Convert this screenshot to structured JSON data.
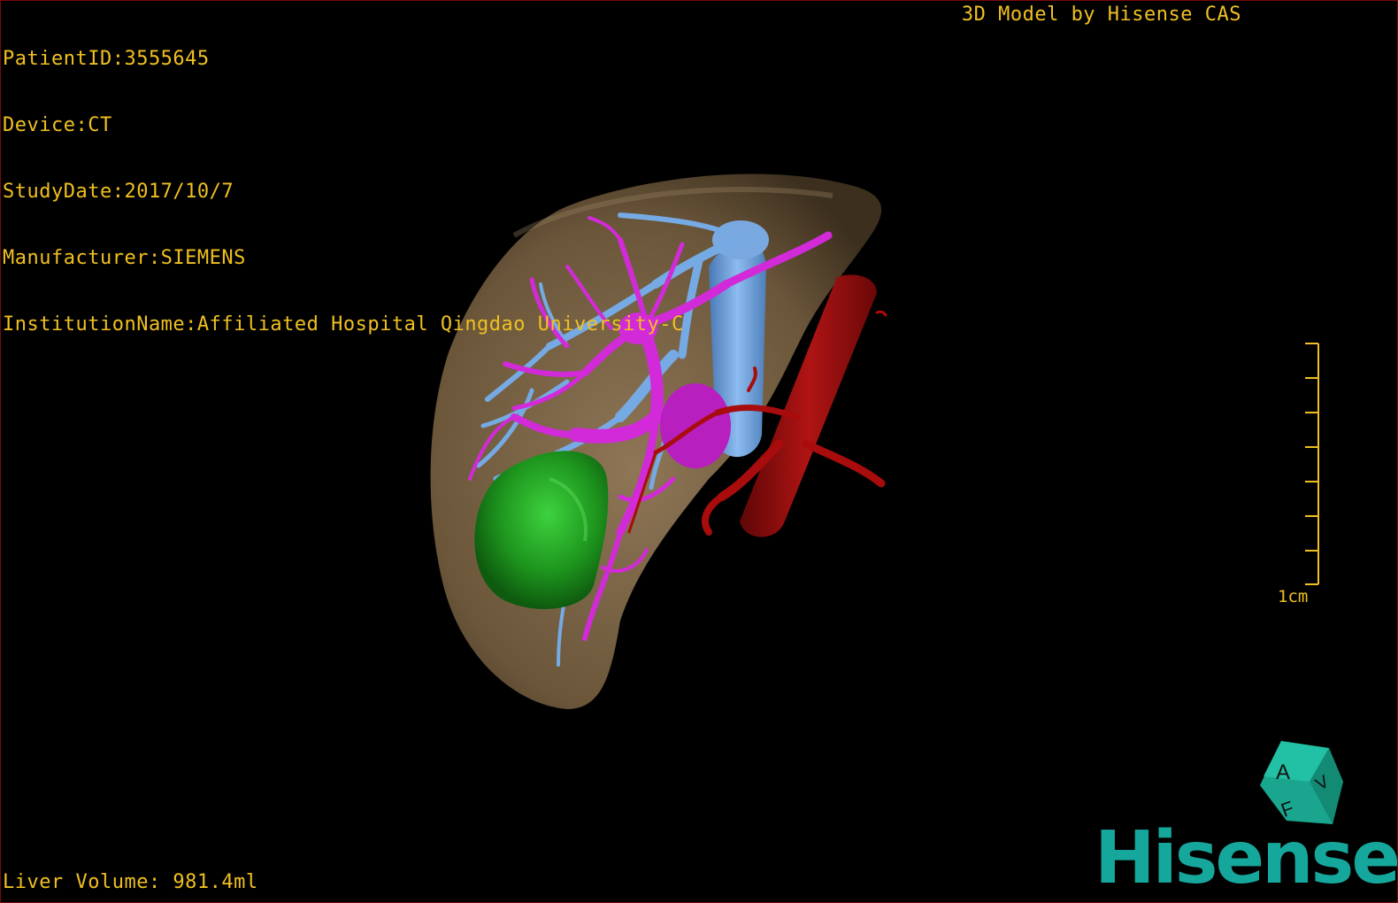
{
  "study_info": {
    "patient_id": "PatientID:3555645",
    "device": "Device:CT",
    "study_date": "StudyDate:2017/10/7",
    "manufacturer": "Manufacturer:SIEMENS",
    "institution": "InstitutionName:Affiliated Hospital Qingdao University-C"
  },
  "header_title": "3D Model by Hisense CAS",
  "liver_volume": "Liver Volume: 981.4ml",
  "scale_bar": {
    "label": "1cm",
    "ticks": 8
  },
  "orientation_cube": {
    "labels": [
      "A",
      "F",
      "V"
    ]
  },
  "logo_text": "Hisense",
  "colors": {
    "overlay_text": "#f0c020",
    "liver": "#7a6446",
    "portal_vein": "#d22ad8",
    "hepatic_vein": "#6fa4dc",
    "artery": "#a80c0c",
    "tumor": "#1f9a1f",
    "brand": "#16a79c"
  }
}
